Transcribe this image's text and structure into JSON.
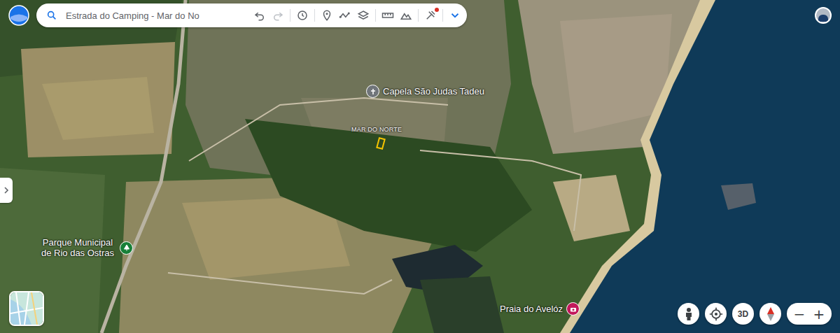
{
  "search": {
    "value": "Estrada do Camping - Mar do No"
  },
  "toolbar": {
    "tools_notification": true
  },
  "labels": [
    {
      "text": "Capela São Judas Tadeu",
      "kind": "place"
    },
    {
      "text": "MAR DO NORTE",
      "kind": "area"
    },
    {
      "text": "Parque Municipal de Rio das Ostras",
      "kind": "park"
    },
    {
      "text": "Praia do Avelóz",
      "kind": "beach"
    }
  ],
  "controls": {
    "view_button": "3D",
    "zoom_out": "−",
    "zoom_in": "+"
  }
}
